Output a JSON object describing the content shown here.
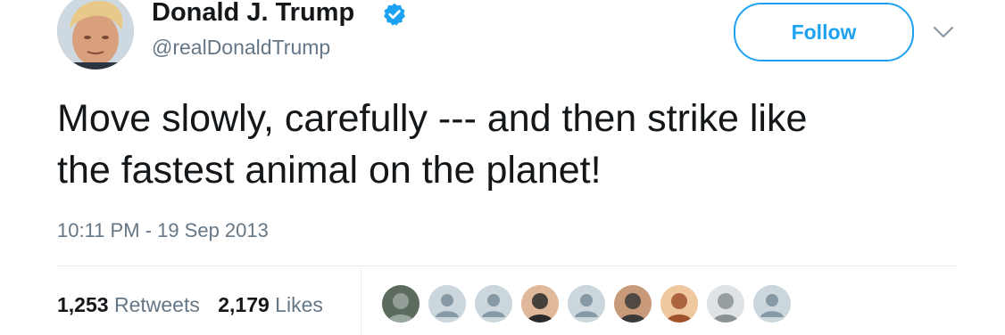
{
  "user": {
    "display_name": "Donald J. Trump",
    "handle": "@realDonaldTrump",
    "verified": true,
    "avatar_icon": "profile-photo"
  },
  "actions": {
    "follow_label": "Follow",
    "menu_icon": "chevron-down-icon"
  },
  "tweet": {
    "text": "Move slowly, carefully --- and then strike like\nthe fastest animal on the planet!",
    "timestamp": "10:11 PM - 19 Sep 2013"
  },
  "stats": {
    "retweets_count": "1,253",
    "retweets_label": "Retweets",
    "likes_count": "2,179",
    "likes_label": "Likes"
  },
  "likers": [
    {
      "kind": "photo",
      "icon": "liker-photo-icon"
    },
    {
      "kind": "default",
      "icon": "default-avatar-icon"
    },
    {
      "kind": "default",
      "icon": "default-avatar-icon"
    },
    {
      "kind": "photo",
      "icon": "liker-photo-icon"
    },
    {
      "kind": "default",
      "icon": "default-avatar-icon"
    },
    {
      "kind": "photo",
      "icon": "liker-photo-icon"
    },
    {
      "kind": "photo",
      "icon": "liker-photo-icon"
    },
    {
      "kind": "photo",
      "icon": "liker-photo-icon"
    },
    {
      "kind": "default",
      "icon": "default-avatar-icon"
    }
  ],
  "colors": {
    "accent": "#1da1f2",
    "text_primary": "#14171a",
    "text_secondary": "#657786",
    "divider": "#e6ecf0"
  }
}
